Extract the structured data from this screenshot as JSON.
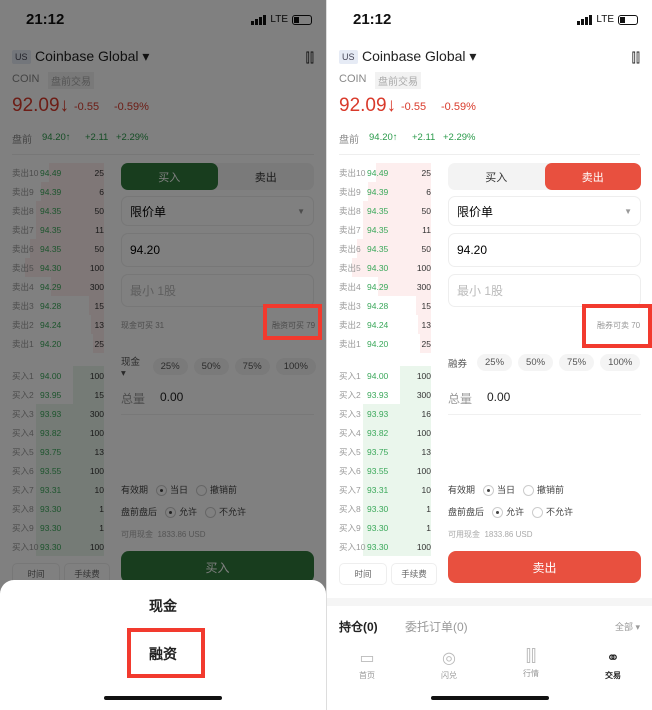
{
  "status": {
    "time": "21:12",
    "network": "LTE"
  },
  "header": {
    "market": "US",
    "name": "Coinbase Global ▾",
    "symbol": "COIN",
    "session": "盘前交易",
    "price": "92.09↓",
    "change": "-0.55",
    "change_pct": "-0.59%",
    "pre_label": "盘前",
    "pre_price": "94.20↑",
    "pre_change": "+2.11",
    "pre_pct": "+2.29%"
  },
  "colors": {
    "up": "#2a9a4a",
    "down": "#d93a2b",
    "buy": "#2f7a3c",
    "sell": "#e8503f",
    "highlight": "#f23a2e"
  },
  "asks": [
    {
      "l": "卖出10",
      "p": "94.49",
      "q": "25"
    },
    {
      "l": "卖出9",
      "p": "94.39",
      "q": "6"
    },
    {
      "l": "卖出8",
      "p": "94.35",
      "q": "50"
    },
    {
      "l": "卖出7",
      "p": "94.35",
      "q": "11"
    },
    {
      "l": "卖出6",
      "p": "94.35",
      "q": "50"
    },
    {
      "l": "卖出5",
      "p": "94.30",
      "q": "100"
    },
    {
      "l": "卖出4",
      "p": "94.29",
      "q": "300"
    },
    {
      "l": "卖出3",
      "p": "94.28",
      "q": "15"
    },
    {
      "l": "卖出2",
      "p": "94.24",
      "q": "13"
    },
    {
      "l": "卖出1",
      "p": "94.20",
      "q": "25"
    }
  ],
  "left": {
    "bids": [
      {
        "l": "买入1",
        "p": "94.00",
        "q": "100"
      },
      {
        "l": "买入2",
        "p": "93.95",
        "q": "15"
      },
      {
        "l": "买入3",
        "p": "93.93",
        "q": "300"
      },
      {
        "l": "买入4",
        "p": "93.82",
        "q": "100"
      },
      {
        "l": "买入5",
        "p": "93.75",
        "q": "13"
      },
      {
        "l": "买入6",
        "p": "93.55",
        "q": "100"
      },
      {
        "l": "买入7",
        "p": "93.31",
        "q": "10"
      },
      {
        "l": "买入8",
        "p": "93.30",
        "q": "1"
      },
      {
        "l": "买入9",
        "p": "93.30",
        "q": "1"
      },
      {
        "l": "买入10",
        "p": "93.30",
        "q": "100"
      }
    ],
    "cash_buy": "现金可买 31",
    "margin_buy": "融资可买 79",
    "mode": "现金 ▾",
    "submit": "买入",
    "sheet": {
      "opt1": "现金",
      "opt2": "融资"
    }
  },
  "right": {
    "bids": [
      {
        "l": "买入1",
        "p": "94.00",
        "q": "100"
      },
      {
        "l": "买入2",
        "p": "93.93",
        "q": "300"
      },
      {
        "l": "买入3",
        "p": "93.93",
        "q": "16"
      },
      {
        "l": "买入4",
        "p": "93.82",
        "q": "100"
      },
      {
        "l": "买入5",
        "p": "93.75",
        "q": "13"
      },
      {
        "l": "买入6",
        "p": "93.55",
        "q": "100"
      },
      {
        "l": "买入7",
        "p": "93.31",
        "q": "10"
      },
      {
        "l": "买入8",
        "p": "93.30",
        "q": "1"
      },
      {
        "l": "买入9",
        "p": "93.30",
        "q": "1"
      },
      {
        "l": "买入10",
        "p": "93.30",
        "q": "100"
      }
    ],
    "short_sell": "融券可卖 70",
    "mode": "融券",
    "submit": "卖出",
    "positions": "持仓(0)",
    "orders": "委托订单(0)",
    "filter": "全部 ▾",
    "nav": [
      "首页",
      "闪兑",
      "行情",
      "交易"
    ]
  },
  "form": {
    "buy_tab": "买入",
    "sell_tab": "卖出",
    "order_type": "限价单",
    "price": "94.20",
    "qty_placeholder": "最小 1股",
    "pcts": [
      "25%",
      "50%",
      "75%",
      "100%"
    ],
    "total_label": "总量",
    "total": "0.00",
    "validity_label": "有效期",
    "validity_opts": [
      "当日",
      "撤销前"
    ],
    "ext_label": "盘前盘后",
    "ext_opts": [
      "允许",
      "不允许"
    ],
    "avail": "可用现金",
    "avail_val": "1833.86 USD",
    "time_btn": "时间",
    "fee_btn": "手续费"
  }
}
